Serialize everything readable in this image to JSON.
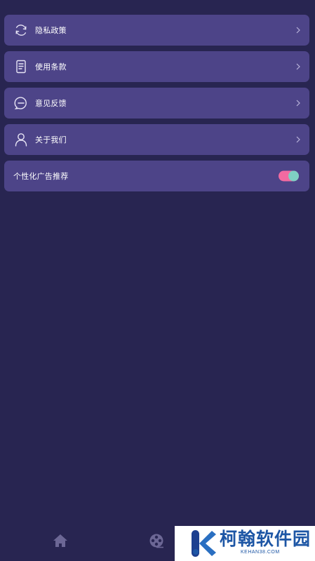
{
  "menu": {
    "items": [
      {
        "label": "隐私政策",
        "icon": "refresh-cycle-icon"
      },
      {
        "label": "使用条款",
        "icon": "document-icon"
      },
      {
        "label": "意见反馈",
        "icon": "chat-bubble-icon"
      },
      {
        "label": "关于我们",
        "icon": "person-icon"
      }
    ],
    "toggle": {
      "label": "个性化广告推荐",
      "enabled": true
    }
  },
  "tabbar": {
    "tabs": [
      {
        "icon": "home-icon"
      },
      {
        "icon": "film-reel-icon"
      },
      {
        "icon": "profile-icon"
      }
    ]
  },
  "watermark": {
    "text": "柯翰软件园",
    "subtext": "KEHAN38.COM"
  },
  "colors": {
    "background": "#282551",
    "card": "#4d4488",
    "toggle_track": "#f26aa1",
    "toggle_knob": "#7fcfc3",
    "watermark_blue": "#1d56a5"
  }
}
